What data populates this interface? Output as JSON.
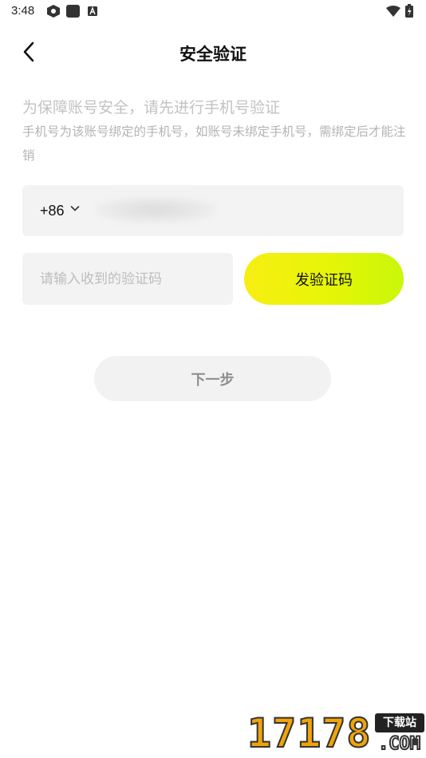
{
  "status_bar": {
    "time": "3:48",
    "icons": [
      "app-shield-icon",
      "app-square-icon",
      "app-a-icon",
      "wifi-icon",
      "battery-icon"
    ]
  },
  "header": {
    "title": "安全验证",
    "back_icon": "chevron-left-icon"
  },
  "description": {
    "line1": "为保障账号安全，请先进行手机号验证",
    "line2": "手机号为该账号绑定的手机号，如账号未绑定手机号，需绑定后才能注销"
  },
  "phone": {
    "country_code": "+86",
    "dropdown_icon": "chevron-down-icon",
    "number_obscured": true
  },
  "verification": {
    "placeholder": "请输入收到的验证码",
    "value": "",
    "send_label": "发验证码"
  },
  "actions": {
    "next_label": "下一步"
  },
  "watermark": {
    "number": "17178",
    "tag": "下载站",
    "domain": ".COM"
  },
  "colors": {
    "accent_start": "#f7ee12",
    "accent_end": "#c9f70a",
    "field_bg": "#f3f3f3",
    "hint_text": "#bdbdbd"
  }
}
